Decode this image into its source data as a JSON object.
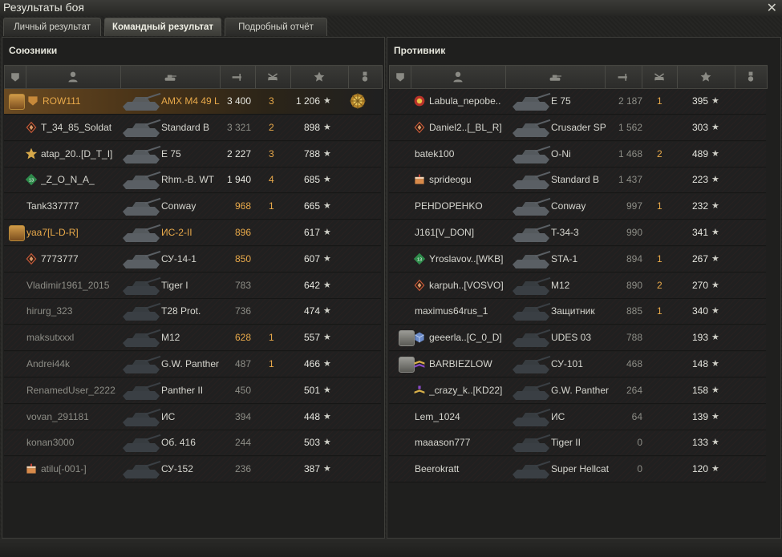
{
  "window": {
    "title": "Результаты боя"
  },
  "tabs": [
    {
      "label": "Личный результат",
      "active": false
    },
    {
      "label": "Командный результат",
      "active": true
    },
    {
      "label": "Подробный отчёт",
      "active": false
    }
  ],
  "allies": {
    "title": "Союзники",
    "rows": [
      {
        "platoon": "gold",
        "badge": "gold-shield",
        "name": "ROW111",
        "tank": "AMX M4 49 L",
        "damage": "3 400",
        "kills": "3",
        "xp": "1 206",
        "medal": true,
        "highlight": true
      },
      {
        "badge": "diamond",
        "name": "T_34_85_Soldat",
        "tank": "Standard B",
        "damage": "3 321",
        "kills": "2",
        "xp": "898"
      },
      {
        "badge": "star-medal",
        "name": "atap_20..[D_T_I]",
        "tank": "E 75",
        "damage": "2 227",
        "kills": "3",
        "xp": "788"
      },
      {
        "badge": "green-rank",
        "name": "_Z_O_N_A_",
        "tank": "Rhm.-B. WT",
        "damage": "1 940",
        "kills": "4",
        "xp": "685"
      },
      {
        "name": "Tank337777",
        "tank": "Conway",
        "damage": "968",
        "kills": "1",
        "xp": "665"
      },
      {
        "platoon": "gold",
        "name": "yaa7[L-D-R]",
        "tank": "ИС-2-II",
        "damage": "896",
        "kills": "",
        "xp": "617"
      },
      {
        "badge": "diamond",
        "name": "7773777",
        "tank": "СУ-14-1",
        "damage": "850",
        "kills": "",
        "xp": "607"
      },
      {
        "name": "Vladimir1961_2015",
        "tank": "Tiger I",
        "damage": "783",
        "kills": "",
        "xp": "642"
      },
      {
        "name": "hirurg_323",
        "tank": "T28 Prot.",
        "damage": "736",
        "kills": "",
        "xp": "474"
      },
      {
        "name": "maksutxxxl",
        "tank": "M12",
        "damage": "628",
        "kills": "1",
        "xp": "557"
      },
      {
        "name": "Andrei44k",
        "tank": "G.W. Panther",
        "damage": "487",
        "kills": "1",
        "xp": "466"
      },
      {
        "name": "RenamedUser_2222..",
        "tank": "Panther II",
        "damage": "450",
        "kills": "",
        "xp": "501"
      },
      {
        "name": "vovan_291181",
        "tank": "ИС",
        "damage": "394",
        "kills": "",
        "xp": "448"
      },
      {
        "name": "konan3000",
        "tank": "Об. 416",
        "damage": "244",
        "kills": "",
        "xp": "503"
      },
      {
        "badge": "cake",
        "name": "atilu[-001-]",
        "tank": "СУ-152",
        "damage": "236",
        "kills": "",
        "xp": "387"
      }
    ]
  },
  "enemies": {
    "title": "Противник",
    "rows": [
      {
        "badge": "red-rank",
        "name": "Labula_nepobe..",
        "tank": "E 75",
        "damage": "2 187",
        "kills": "1",
        "xp": "395"
      },
      {
        "badge": "diamond",
        "name": "Daniel2..[_BL_R]",
        "tank": "Crusader SP",
        "damage": "1 562",
        "kills": "",
        "xp": "303"
      },
      {
        "name": "batek100",
        "tank": "O-Ni",
        "damage": "1 468",
        "kills": "2",
        "xp": "489"
      },
      {
        "badge": "cake",
        "name": "sprideogu",
        "tank": "Standard B",
        "damage": "1 437",
        "kills": "",
        "xp": "223"
      },
      {
        "name": "PEHDOPEHKO",
        "tank": "Conway",
        "damage": "997",
        "kills": "1",
        "xp": "232"
      },
      {
        "name": "J161[V_DON]",
        "tank": "T-34-3",
        "damage": "990",
        "kills": "",
        "xp": "341"
      },
      {
        "badge": "green-rank",
        "name": "Yroslavov..[WKB]",
        "tank": "STA-1",
        "damage": "894",
        "kills": "1",
        "xp": "267"
      },
      {
        "badge": "diamond",
        "name": "karpuh..[VOSVO]",
        "tank": "M12",
        "damage": "890",
        "kills": "2",
        "xp": "270"
      },
      {
        "name": "maximus64rus_1",
        "tank": "Защитник",
        "damage": "885",
        "kills": "1",
        "xp": "340"
      },
      {
        "platoon": "grey",
        "badge": "blue-cube",
        "name": "geeerla..[C_0_D]",
        "tank": "UDES 03",
        "damage": "788",
        "kills": "",
        "xp": "193"
      },
      {
        "platoon": "grey",
        "badge": "chevron",
        "name": "BARBIEZLOW",
        "tank": "СУ-101",
        "damage": "468",
        "kills": "",
        "xp": "148"
      },
      {
        "badge": "chevron1",
        "name": "_crazy_k..[KD22]",
        "tank": "G.W. Panther",
        "damage": "264",
        "kills": "",
        "xp": "158"
      },
      {
        "name": "Lem_1024",
        "tank": "ИС",
        "damage": "64",
        "kills": "",
        "xp": "139"
      },
      {
        "name": "maaason777",
        "tank": "Tiger II",
        "damage": "0",
        "kills": "",
        "xp": "133"
      },
      {
        "name": "Beerokratt",
        "tank": "Super Hellcat",
        "damage": "0",
        "kills": "",
        "xp": "120"
      }
    ]
  },
  "icons": {
    "header": [
      "platoon-icon",
      "player-icon",
      "tank-icon",
      "damage-icon",
      "kills-icon",
      "xp-star-icon",
      "medal-icon"
    ],
    "star": "★",
    "close": "✕"
  },
  "colors": {
    "gold": "#e8a94a",
    "dim": "#8d8d86",
    "normal": "#d6d6cf"
  }
}
